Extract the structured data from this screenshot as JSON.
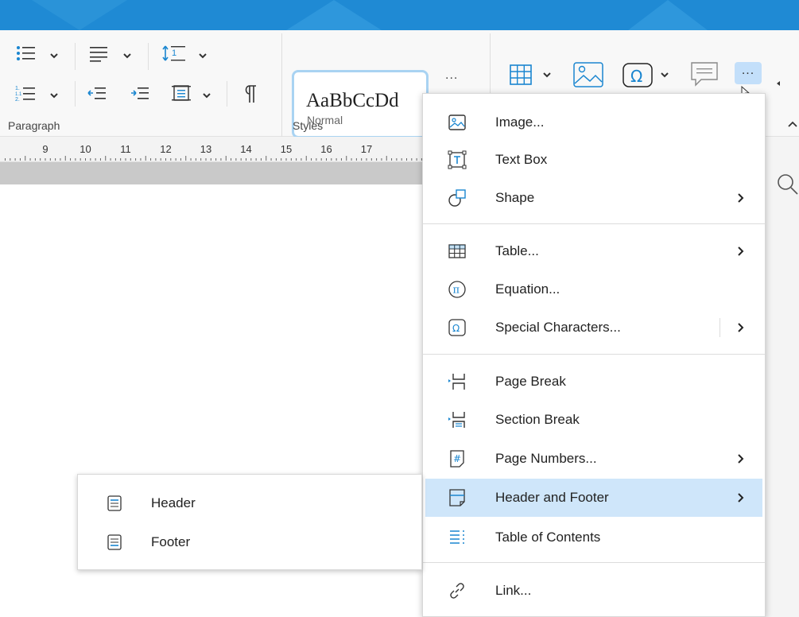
{
  "ribbon": {
    "paragraph_label": "Paragraph",
    "styles_label": "Styles",
    "style_preview_sample": "AaBbCcDd",
    "style_preview_name": "Normal",
    "more_styles_label": "...",
    "more_insert_label": "..."
  },
  "ruler": {
    "numbers": [
      "9",
      "10",
      "11",
      "12",
      "13",
      "14",
      "15",
      "16",
      "17"
    ]
  },
  "insert_menu": {
    "items": [
      {
        "label": "Image...",
        "icon": "image-icon",
        "has_submenu": false
      },
      {
        "label": "Text Box",
        "icon": "text-box-icon",
        "has_submenu": false
      },
      {
        "label": "Shape",
        "icon": "shape-icon",
        "has_submenu": true
      },
      {
        "label": "Table...",
        "icon": "table-icon",
        "has_submenu": true
      },
      {
        "label": "Equation...",
        "icon": "equation-icon",
        "has_submenu": false
      },
      {
        "label": "Special Characters...",
        "icon": "omega-icon",
        "has_submenu": true
      },
      {
        "label": "Page Break",
        "icon": "page-break-icon",
        "has_submenu": false
      },
      {
        "label": "Section Break",
        "icon": "section-break-icon",
        "has_submenu": false
      },
      {
        "label": "Page Numbers...",
        "icon": "page-numbers-icon",
        "has_submenu": true
      },
      {
        "label": "Header and Footer",
        "icon": "header-footer-icon",
        "has_submenu": true,
        "highlighted": true
      },
      {
        "label": "Table of Contents",
        "icon": "toc-icon",
        "has_submenu": false
      },
      {
        "label": "Link...",
        "icon": "link-icon",
        "has_submenu": false
      }
    ]
  },
  "header_footer_submenu": {
    "items": [
      {
        "label": "Header",
        "icon": "header-icon"
      },
      {
        "label": "Footer",
        "icon": "footer-icon"
      }
    ]
  },
  "colors": {
    "title_bar": "#1f8ad4",
    "accent": "#1a86d0",
    "highlight": "#cfe6fa"
  }
}
